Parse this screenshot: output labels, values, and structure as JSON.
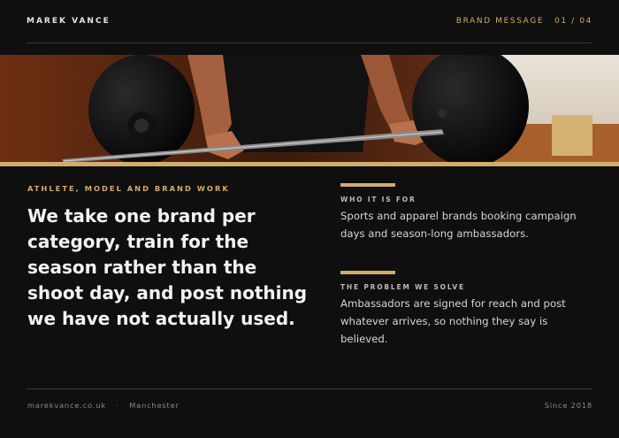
{
  "header": {
    "brand_name": "MAREK VANCE",
    "section_label": "BRAND MESSAGE",
    "page_counter": "01 / 04"
  },
  "hero": {
    "image_alt": "Athlete gripping a loaded barbell",
    "accent_color": "#d3ab6c"
  },
  "main": {
    "eyebrow": "ATHLETE, MODEL AND BRAND WORK",
    "headline": "We take one brand per category, train for the season rather than the shoot day, and post nothing we have not actually used.",
    "blocks": [
      {
        "label": "WHO IT IS FOR",
        "text": "Sports and apparel brands booking campaign days and season-long ambassadors."
      },
      {
        "label": "THE PROBLEM WE SOLVE",
        "text": "Ambassadors are signed for reach and post whatever arrives, so nothing they say is believed."
      }
    ]
  },
  "footer": {
    "website": "marekvance.co.uk",
    "separator": "·",
    "city": "Manchester",
    "since": "Since 2018"
  }
}
